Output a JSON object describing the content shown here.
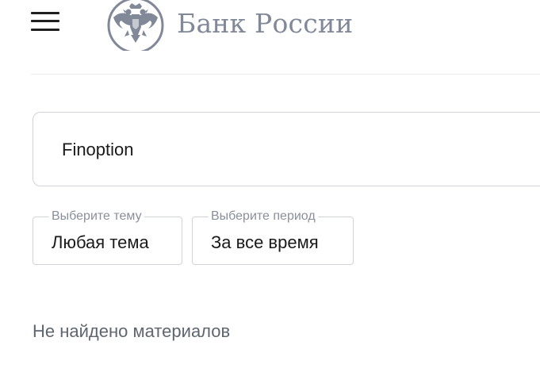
{
  "header": {
    "menu_icon": "hamburger-menu-icon",
    "logo_icon": "double-headed-eagle-emblem-icon",
    "logo_text": "Банк России"
  },
  "search": {
    "value": "Finoption"
  },
  "filters": {
    "topic": {
      "legend": "Выберите тему",
      "value": "Любая тема"
    },
    "period": {
      "legend": "Выберите период",
      "value": "За все время"
    }
  },
  "results": {
    "empty_message": "Не найдено материалов"
  },
  "colors": {
    "logo_gray": "#818898",
    "border": "#d0d4da",
    "legend_text": "#8a909b",
    "muted_text": "#5f6670"
  }
}
